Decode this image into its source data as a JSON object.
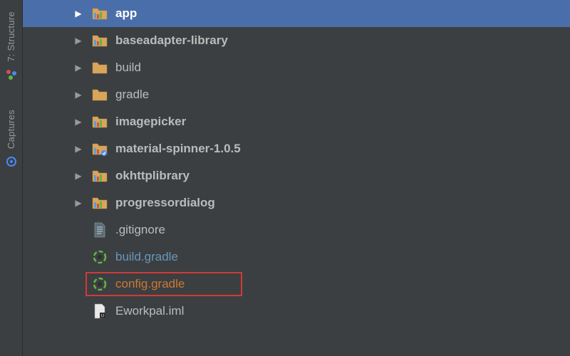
{
  "sidebar": {
    "tabs": [
      {
        "label": "7: Structure"
      },
      {
        "label": "Captures"
      }
    ]
  },
  "tree": {
    "items": [
      {
        "name": "app",
        "type": "module",
        "expandable": true,
        "selected": true,
        "bold": true,
        "color": "default"
      },
      {
        "name": "baseadapter-library",
        "type": "module",
        "expandable": true,
        "selected": false,
        "bold": true,
        "color": "default"
      },
      {
        "name": "build",
        "type": "folder",
        "expandable": true,
        "selected": false,
        "bold": false,
        "color": "default"
      },
      {
        "name": "gradle",
        "type": "folder",
        "expandable": true,
        "selected": false,
        "bold": false,
        "color": "default"
      },
      {
        "name": "imagepicker",
        "type": "module",
        "expandable": true,
        "selected": false,
        "bold": true,
        "color": "default"
      },
      {
        "name": "material-spinner-1.0.5",
        "type": "module-ext",
        "expandable": true,
        "selected": false,
        "bold": true,
        "color": "default"
      },
      {
        "name": "okhttplibrary",
        "type": "module",
        "expandable": true,
        "selected": false,
        "bold": true,
        "color": "default"
      },
      {
        "name": "progressordialog",
        "type": "module",
        "expandable": true,
        "selected": false,
        "bold": true,
        "color": "default"
      },
      {
        "name": ".gitignore",
        "type": "textfile",
        "expandable": false,
        "selected": false,
        "bold": false,
        "color": "default"
      },
      {
        "name": "build.gradle",
        "type": "gradle",
        "expandable": false,
        "selected": false,
        "bold": false,
        "color": "blue"
      },
      {
        "name": "config.gradle",
        "type": "gradle",
        "expandable": false,
        "selected": false,
        "bold": false,
        "color": "orange",
        "highlight": true
      },
      {
        "name": "Eworkpal.iml",
        "type": "iml",
        "expandable": false,
        "selected": false,
        "bold": false,
        "color": "default"
      }
    ]
  }
}
